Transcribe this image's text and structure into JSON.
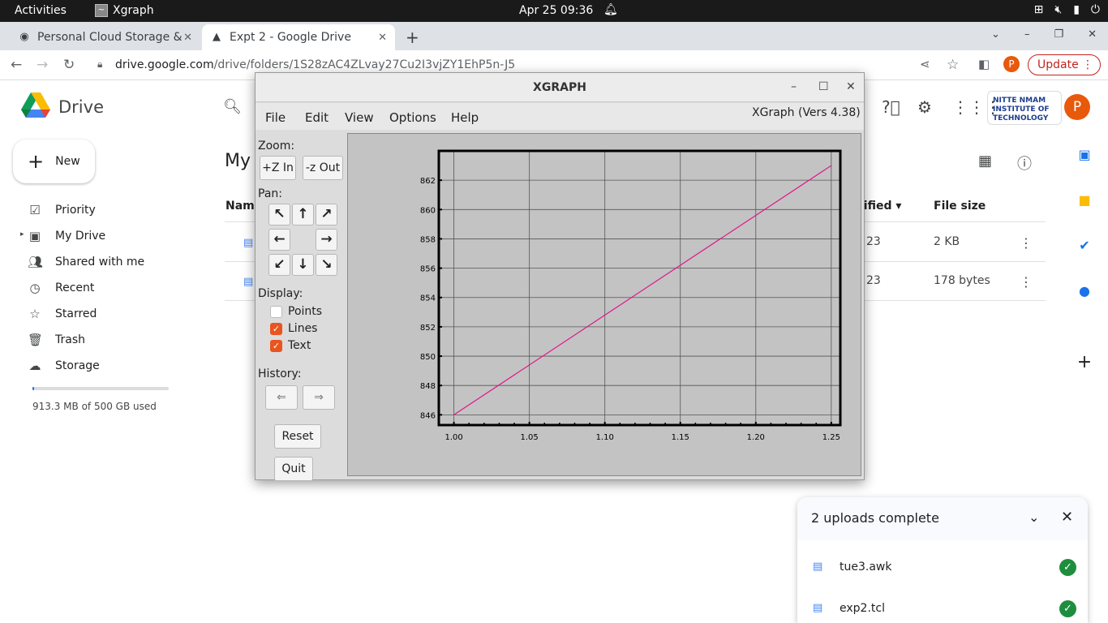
{
  "topbar": {
    "activities": "Activities",
    "app_name": "Xgraph",
    "clock": "Apr 25  09:36"
  },
  "browser": {
    "tabs": [
      {
        "title": "Personal Cloud Storage &",
        "active": false
      },
      {
        "title": "Expt 2 - Google Drive",
        "active": true
      }
    ],
    "url_host": "drive.google.com",
    "url_path": "/drive/folders/1S28zAC4ZLvay27Cu2I3vjZY1EhP5n-J5",
    "update_label": "Update",
    "profile_initial": "P"
  },
  "drive": {
    "title": "Drive",
    "new_label": "New",
    "nav": [
      {
        "label": "Priority",
        "icon": "priority-icon"
      },
      {
        "label": "My Drive",
        "icon": "my-drive-icon"
      },
      {
        "label": "Shared with me",
        "icon": "shared-icon"
      },
      {
        "label": "Recent",
        "icon": "clock-icon"
      },
      {
        "label": "Starred",
        "icon": "star-icon"
      },
      {
        "label": "Trash",
        "icon": "trash-icon"
      },
      {
        "label": "Storage",
        "icon": "cloud-icon"
      }
    ],
    "storage_text": "913.3 MB of 500 GB used",
    "storage_fraction": 0.0018,
    "page_title": "My",
    "columns": {
      "name": "Name",
      "modified": "lified",
      "size": "File size"
    },
    "files": [
      {
        "modified": "23",
        "size": "2 KB"
      },
      {
        "modified": "23",
        "size": "178 bytes"
      }
    ],
    "avatar_initial": "P",
    "org_logo_text": "NITTE NMAM INSTITUTE OF TECHNOLOGY"
  },
  "uploads": {
    "title": "2 uploads complete",
    "items": [
      {
        "name": "tue3.awk"
      },
      {
        "name": "exp2.tcl"
      }
    ]
  },
  "xgraph": {
    "window_title": "XGRAPH",
    "version": "XGraph (Vers 4.38)",
    "menus": [
      "File",
      "Edit",
      "View",
      "Options",
      "Help"
    ],
    "zoom_label": "Zoom:",
    "zoom_in": "+Z In",
    "zoom_out": "-z Out",
    "pan_label": "Pan:",
    "display_label": "Display:",
    "display_options": [
      {
        "label": "Points",
        "checked": false
      },
      {
        "label": "Lines",
        "checked": true
      },
      {
        "label": "Text",
        "checked": true
      }
    ],
    "history_label": "History:",
    "reset_label": "Reset",
    "quit_label": "Quit"
  },
  "chart_data": {
    "type": "line",
    "title": "",
    "xlabel": "",
    "ylabel": "",
    "xlim": [
      0.99,
      1.256
    ],
    "ylim": [
      845.3,
      864.0
    ],
    "x_ticks": [
      "1.00",
      "1.05",
      "1.10",
      "1.15",
      "1.20",
      "1.25"
    ],
    "y_ticks": [
      "846",
      "848",
      "850",
      "852",
      "854",
      "856",
      "858",
      "860",
      "862"
    ],
    "grid": true,
    "series": [
      {
        "color": "#e0168c",
        "x": [
          1.0,
          1.25
        ],
        "y": [
          846.0,
          863.0
        ]
      }
    ]
  }
}
